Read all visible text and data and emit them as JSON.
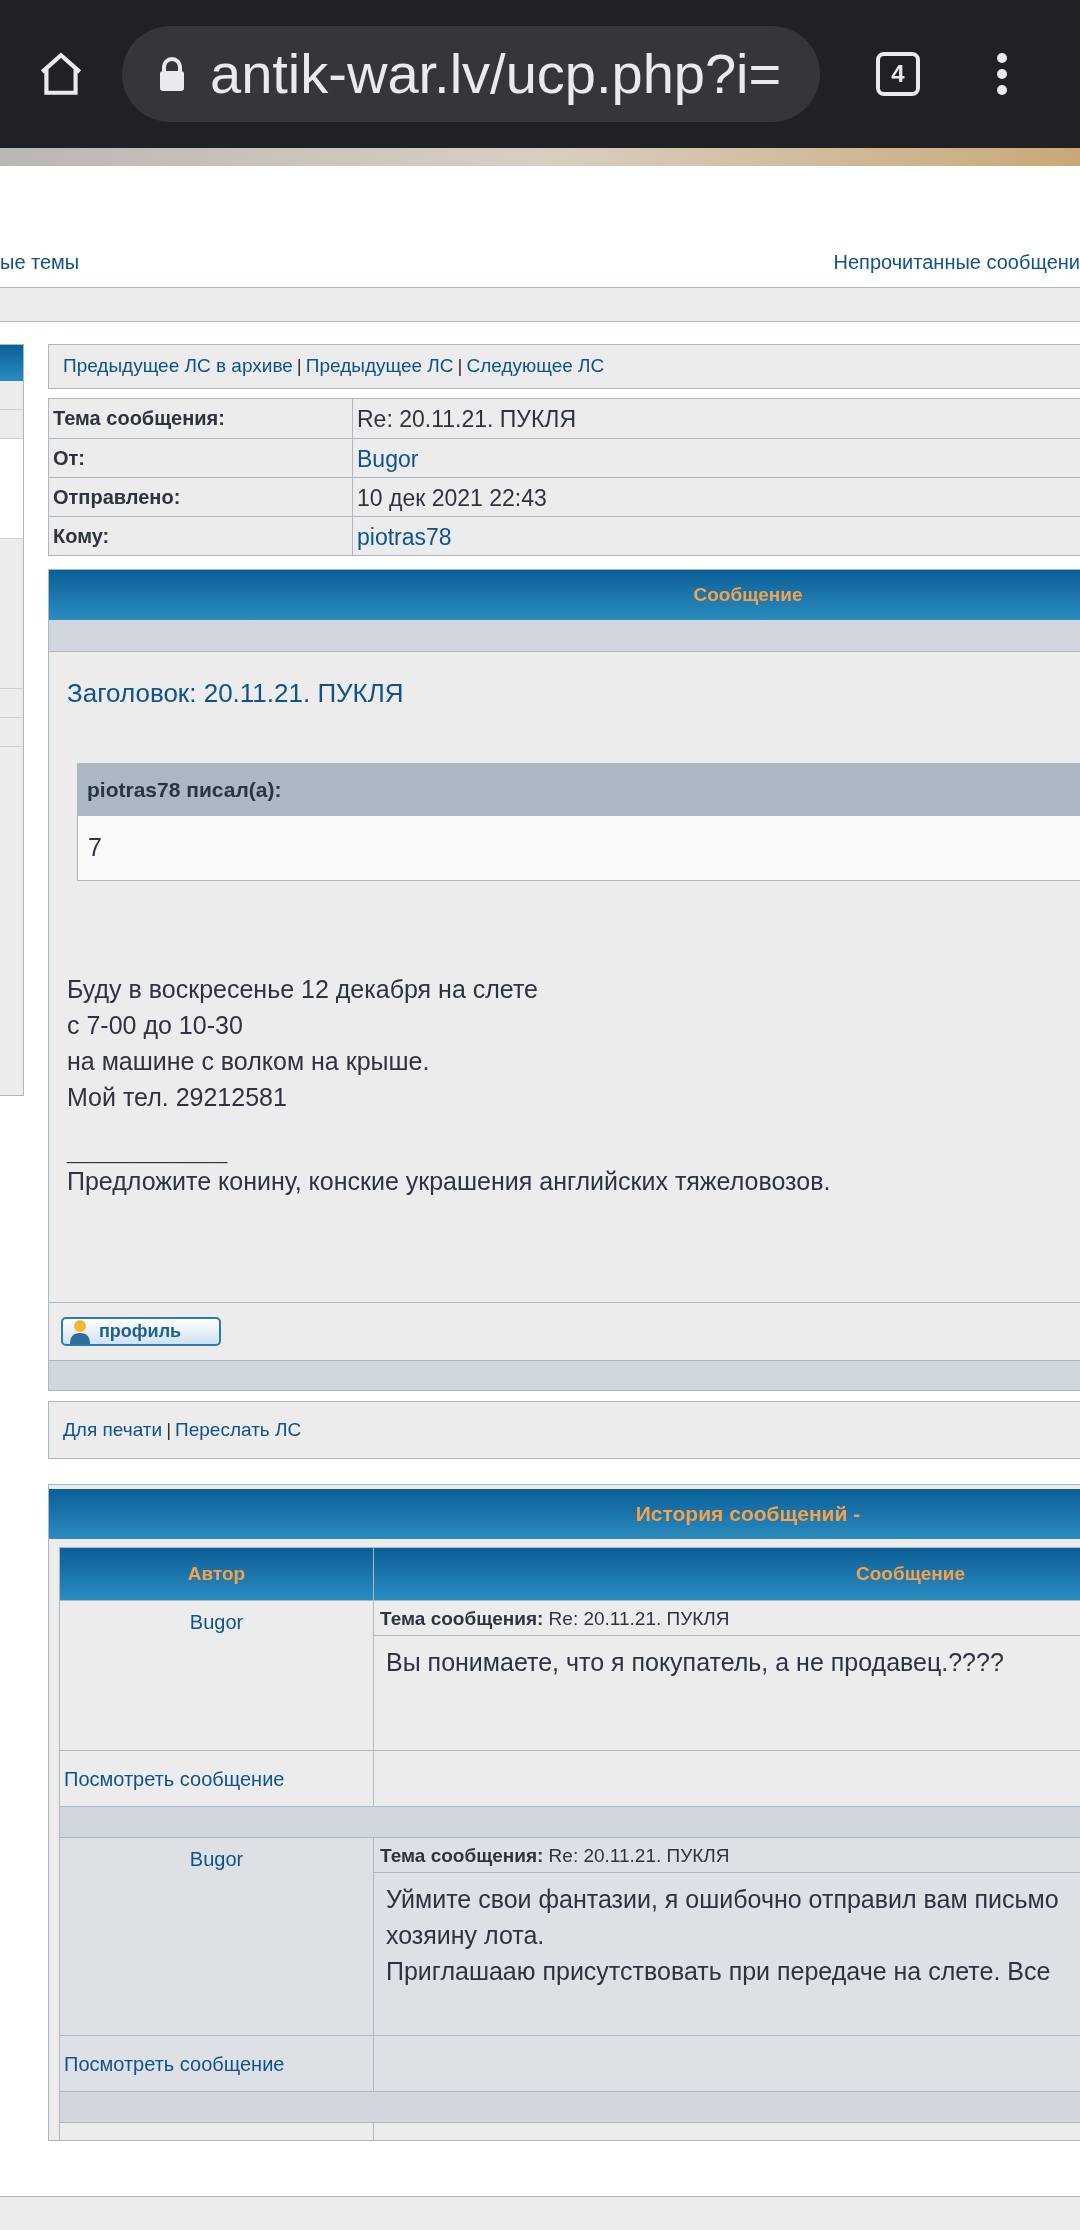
{
  "browser": {
    "url": "antik-war.lv/ucp.php?i=",
    "tab_count": "4"
  },
  "nav_links": [
    {
      "text": "ые темы"
    },
    {
      "text": "Непрочитанные сообщени"
    }
  ],
  "pm_navigation": {
    "separator": "|",
    "links": [
      "Предыдущее ЛС в архиве",
      "Предыдущее ЛС",
      "Следующее ЛС"
    ]
  },
  "message_info": [
    {
      "label": "Тема сообщения:",
      "value": "Re: 20.11.21. ПУКЛЯ",
      "kind": "text"
    },
    {
      "label": "От:",
      "value": "Bugor",
      "kind": "link"
    },
    {
      "label": "Отправлено:",
      "value": "10 дек 2021 22:43",
      "kind": "text"
    },
    {
      "label": "Кому:",
      "value": "piotras78",
      "kind": "link"
    }
  ],
  "message": {
    "header": "Сообщение",
    "title": "Заголовок: 20.11.21. ПУКЛЯ",
    "quote": {
      "author": "piotras78 писал(а):",
      "text": "7"
    },
    "lines": [
      "Буду в воскресенье 12 декабря на слете",
      "с 7-00 до 10-30",
      "на машине с волком на крыше.",
      "Мой тел. 29212581"
    ],
    "signature_rule": "________________",
    "signature": "Предложите конину, конские украшения английских тяжеловозов.",
    "profile_button": "профиль"
  },
  "actions": {
    "separator": "|",
    "links": [
      "Для печати",
      "Переслать ЛС"
    ]
  },
  "history": {
    "title": "История сообщений -",
    "columns": [
      "Автор",
      "Сообщение"
    ],
    "rows": [
      {
        "author": "Bugor",
        "subject_label": "Тема сообщения:",
        "subject": "Re: 20.11.21. ПУКЛЯ",
        "lines": [
          "Вы понимаете, что я покупатель, а не продавец.????"
        ],
        "view_link": "Посмотреть сообщение"
      },
      {
        "author": "Bugor",
        "subject_label": "Тема сообщения:",
        "subject": "Re: 20.11.21. ПУКЛЯ",
        "lines": [
          "Уймите свои фантазии, я ошибочно отправил вам письмо",
          "хозяину лота.",
          "Приглашааю присутствовать при передаче на слете. Все"
        ],
        "view_link": "Посмотреть сообщение"
      }
    ]
  }
}
